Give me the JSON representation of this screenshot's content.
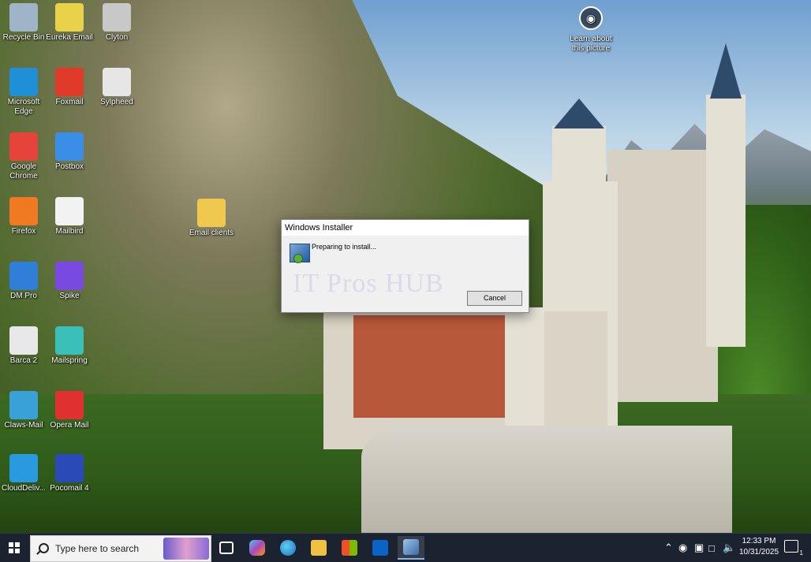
{
  "desktop": {
    "icons": [
      {
        "label": "Recycle Bin",
        "icon": "recycle-bin-icon",
        "color": "#9fb4c8"
      },
      {
        "label": "Eureka Email",
        "icon": "eureka-email-icon",
        "color": "#e8d24a"
      },
      {
        "label": "Clyton",
        "icon": "clyton-icon",
        "color": "#c8c8c8"
      },
      {
        "label": "Microsoft Edge",
        "icon": "edge-icon",
        "color": "#1f8fd8"
      },
      {
        "label": "Foxmail",
        "icon": "foxmail-icon",
        "color": "#e03a2a"
      },
      {
        "label": "Sylpheed",
        "icon": "sylpheed-icon",
        "color": "#e6e6e6"
      },
      {
        "label": "Google Chrome",
        "icon": "chrome-icon",
        "color": "#e6433a"
      },
      {
        "label": "Postbox",
        "icon": "postbox-icon",
        "color": "#3a8ee6"
      },
      {
        "label": "Firefox",
        "icon": "firefox-icon",
        "color": "#f07a22"
      },
      {
        "label": "Mailbird",
        "icon": "mailbird-icon",
        "color": "#f2f2f2"
      },
      {
        "label": "DM Pro",
        "icon": "dm-pro-icon",
        "color": "#2f7ed8"
      },
      {
        "label": "Spike",
        "icon": "spike-icon",
        "color": "#7a4ae0"
      },
      {
        "label": "Barca 2",
        "icon": "barca-icon",
        "color": "#e8e8e8"
      },
      {
        "label": "Mailspring",
        "icon": "mailspring-icon",
        "color": "#3ac0b8"
      },
      {
        "label": "Claws-Mail",
        "icon": "claws-mail-icon",
        "color": "#3aa0d8"
      },
      {
        "label": "Opera Mail",
        "icon": "opera-mail-icon",
        "color": "#e03030"
      },
      {
        "label": "CloudDeliv...",
        "icon": "clouddelivery-icon",
        "color": "#2a9ae0"
      },
      {
        "label": "Pocomail 4",
        "icon": "pocomail-icon",
        "color": "#2a4ab8"
      },
      {
        "label": "Email clients",
        "icon": "folder-icon",
        "color": "#f0c850"
      }
    ],
    "learn_about": "Learn about this picture"
  },
  "dialog": {
    "title": "Windows Installer",
    "message": "Preparing to install...",
    "watermark": "IT Pros HUB",
    "cancel_label": "Cancel"
  },
  "taskbar": {
    "search_placeholder": "Type here to search",
    "apps": [
      "task-view-icon",
      "copilot-icon",
      "edge-icon",
      "file-explorer-icon",
      "store-icon",
      "outlook-icon",
      "installer-icon"
    ],
    "time": "12:33 PM",
    "date": "10/31/2025",
    "notification_count": "1"
  }
}
